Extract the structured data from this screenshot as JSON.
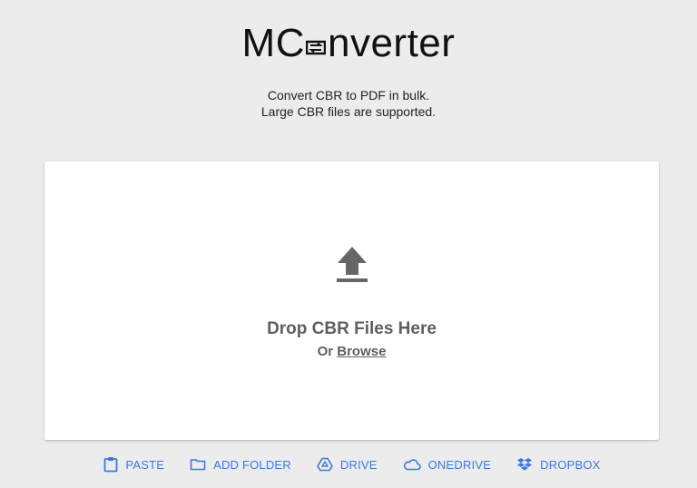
{
  "logo": {
    "prefix": "MC",
    "suffix": "nverter"
  },
  "tagline": {
    "line1": "Convert CBR to PDF in bulk.",
    "line2": "Large CBR files are supported."
  },
  "dropzone": {
    "title": "Drop CBR Files Here",
    "or_text": "Or",
    "browse_label": "Browse"
  },
  "sources": [
    {
      "label": "PASTE",
      "icon": "clipboard-icon"
    },
    {
      "label": "ADD FOLDER",
      "icon": "folder-icon"
    },
    {
      "label": "DRIVE",
      "icon": "google-drive-icon"
    },
    {
      "label": "ONEDRIVE",
      "icon": "onedrive-icon"
    },
    {
      "label": "DROPBOX",
      "icon": "dropbox-icon"
    }
  ],
  "colors": {
    "background": "#ececec",
    "accent": "#3b78e7",
    "icon_gray": "#5f5f5f"
  }
}
